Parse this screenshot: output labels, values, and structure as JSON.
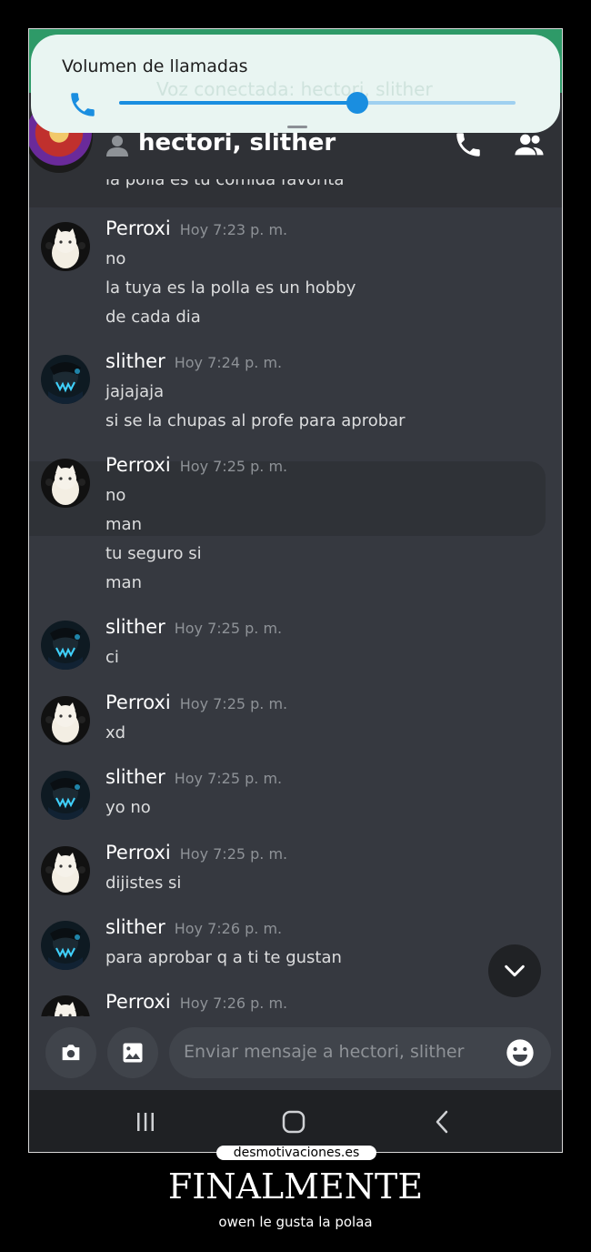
{
  "volume": {
    "title": "Volumen de llamadas",
    "ghost_text": "Voz conectada: hectori, slither",
    "level": 0.6
  },
  "header": {
    "channel": "hectori, slither"
  },
  "cut_text": "la polla es tu comida favorita",
  "messages": [
    {
      "author": "Perroxi",
      "time": "Hoy 7:23 p. m.",
      "lines": [
        "no",
        "la tuya es la polla es un hobby",
        "de cada dia"
      ]
    },
    {
      "author": "slither",
      "time": "Hoy 7:24 p. m.",
      "lines": [
        "jajajaja",
        "si se la chupas al profe para aprobar"
      ]
    },
    {
      "author": "Perroxi",
      "time": "Hoy 7:25 p. m.",
      "lines": [
        "no",
        "man",
        "tu seguro si",
        "man"
      ]
    },
    {
      "author": "slither",
      "time": "Hoy 7:25 p. m.",
      "lines": [
        "ci"
      ]
    },
    {
      "author": "Perroxi",
      "time": "Hoy 7:25 p. m.",
      "lines": [
        "xd"
      ]
    },
    {
      "author": "slither",
      "time": "Hoy 7:25 p. m.",
      "lines": [
        "yo no"
      ]
    },
    {
      "author": "Perroxi",
      "time": "Hoy 7:25 p. m.",
      "lines": [
        "dijistes si"
      ]
    },
    {
      "author": "slither",
      "time": "Hoy 7:26 p. m.",
      "lines": [
        "para aprobar q a ti te gustan"
      ]
    },
    {
      "author": "Perroxi",
      "time": "Hoy 7:26 p. m.",
      "lines": []
    }
  ],
  "input": {
    "placeholder": "Enviar mensaje a hectori, slither"
  },
  "poster": {
    "brand": "desmotivaciones.es",
    "title": "FINALMENTE",
    "subtitle": "owen le gusta la polaa"
  }
}
